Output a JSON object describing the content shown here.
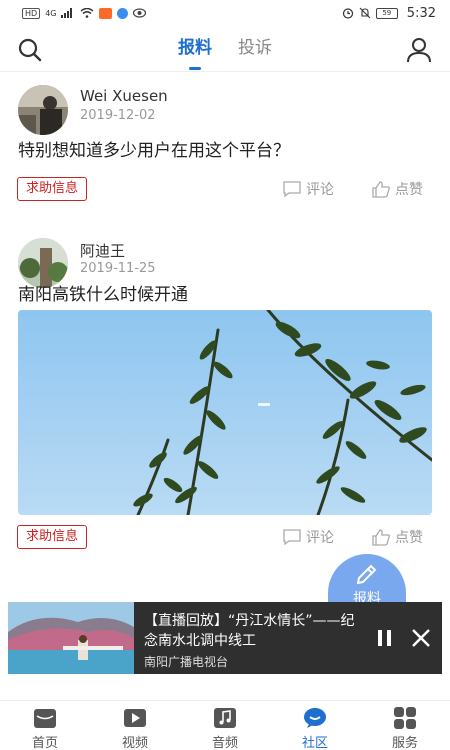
{
  "status_bar": {
    "left_badge": "HD",
    "network": "4G",
    "battery": "59",
    "time": "5:32"
  },
  "header": {
    "tabs": [
      {
        "label": "报料",
        "active": true
      },
      {
        "label": "投诉",
        "active": false
      }
    ],
    "search_icon": "search-icon",
    "user_icon": "user-icon"
  },
  "posts": [
    {
      "author": "Wei Xuesen",
      "date": "2019-12-02",
      "text": "特别想知道多少用户在用这个平台？",
      "tag": "求助信息",
      "comment_label": "评论",
      "like_label": "点赞"
    },
    {
      "author": "阿迪王",
      "date": "2019-11-25",
      "text": "南阳高铁什么时候开通",
      "tag": "求助信息",
      "comment_label": "评论",
      "like_label": "点赞"
    }
  ],
  "fab": {
    "label": "报料",
    "icon": "pencil-icon"
  },
  "player": {
    "title": "【直播回放】“丹江水情长”——纪念南水北调中线工",
    "source": "南阳广播电视台"
  },
  "bottom_nav": [
    {
      "label": "首页",
      "icon": "home-icon",
      "active": false
    },
    {
      "label": "视频",
      "icon": "video-icon",
      "active": false
    },
    {
      "label": "音频",
      "icon": "music-icon",
      "active": false
    },
    {
      "label": "社区",
      "icon": "chat-icon",
      "active": true
    },
    {
      "label": "服务",
      "icon": "grid-icon",
      "active": false
    }
  ],
  "colors": {
    "accent": "#1e6fd0",
    "tag_red": "#cc2222",
    "fab": "#7aa8ef",
    "player_bg": "#2f2f2f"
  }
}
